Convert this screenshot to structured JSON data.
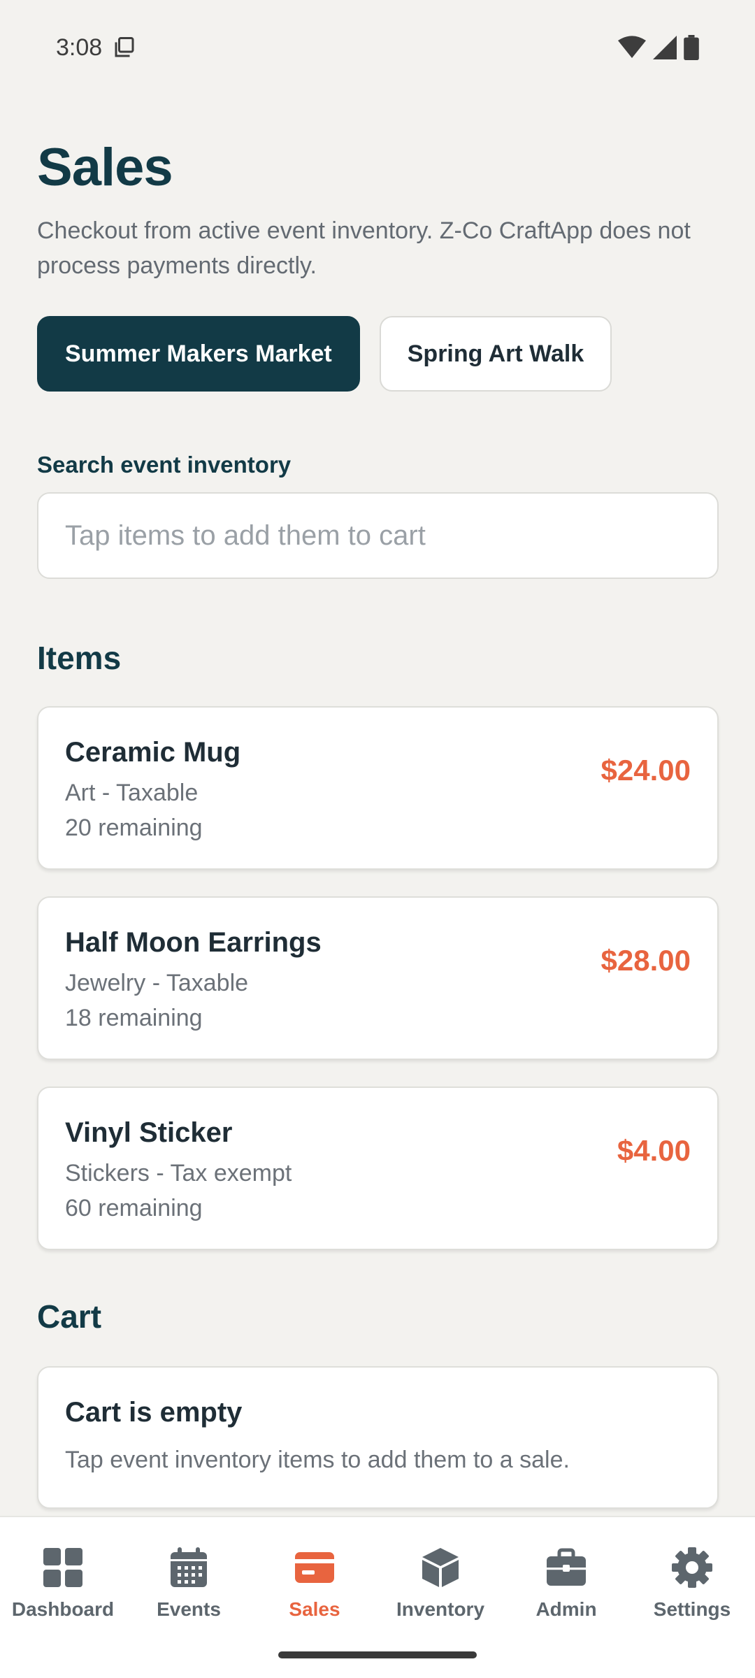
{
  "status_bar": {
    "time": "3:08"
  },
  "header": {
    "title": "Sales",
    "subtitle": "Checkout from active event inventory. Z-Co CraftApp does not process payments directly."
  },
  "events": [
    {
      "label": "Summer Makers Market",
      "active": true
    },
    {
      "label": "Spring Art Walk",
      "active": false
    }
  ],
  "search": {
    "label": "Search event inventory",
    "placeholder": "Tap items to add them to cart",
    "value": ""
  },
  "items_section": {
    "heading": "Items",
    "items": [
      {
        "name": "Ceramic Mug",
        "category_tax": "Art - Taxable",
        "remaining": "20 remaining",
        "price": "$24.00"
      },
      {
        "name": "Half Moon Earrings",
        "category_tax": "Jewelry - Taxable",
        "remaining": "18 remaining",
        "price": "$28.00"
      },
      {
        "name": "Vinyl Sticker",
        "category_tax": "Stickers - Tax exempt",
        "remaining": "60 remaining",
        "price": "$4.00"
      }
    ]
  },
  "cart": {
    "heading": "Cart",
    "empty_title": "Cart is empty",
    "empty_hint": "Tap event inventory items to add them to a sale."
  },
  "nav": {
    "items": [
      {
        "label": "Dashboard",
        "icon": "dashboard-icon"
      },
      {
        "label": "Events",
        "icon": "calendar-icon"
      },
      {
        "label": "Sales",
        "icon": "card-icon",
        "active": true
      },
      {
        "label": "Inventory",
        "icon": "box-icon"
      },
      {
        "label": "Admin",
        "icon": "briefcase-icon"
      },
      {
        "label": "Settings",
        "icon": "gear-icon"
      }
    ]
  },
  "colors": {
    "primary": "#123a46",
    "accent": "#e8643f",
    "background": "#f3f2ef"
  }
}
